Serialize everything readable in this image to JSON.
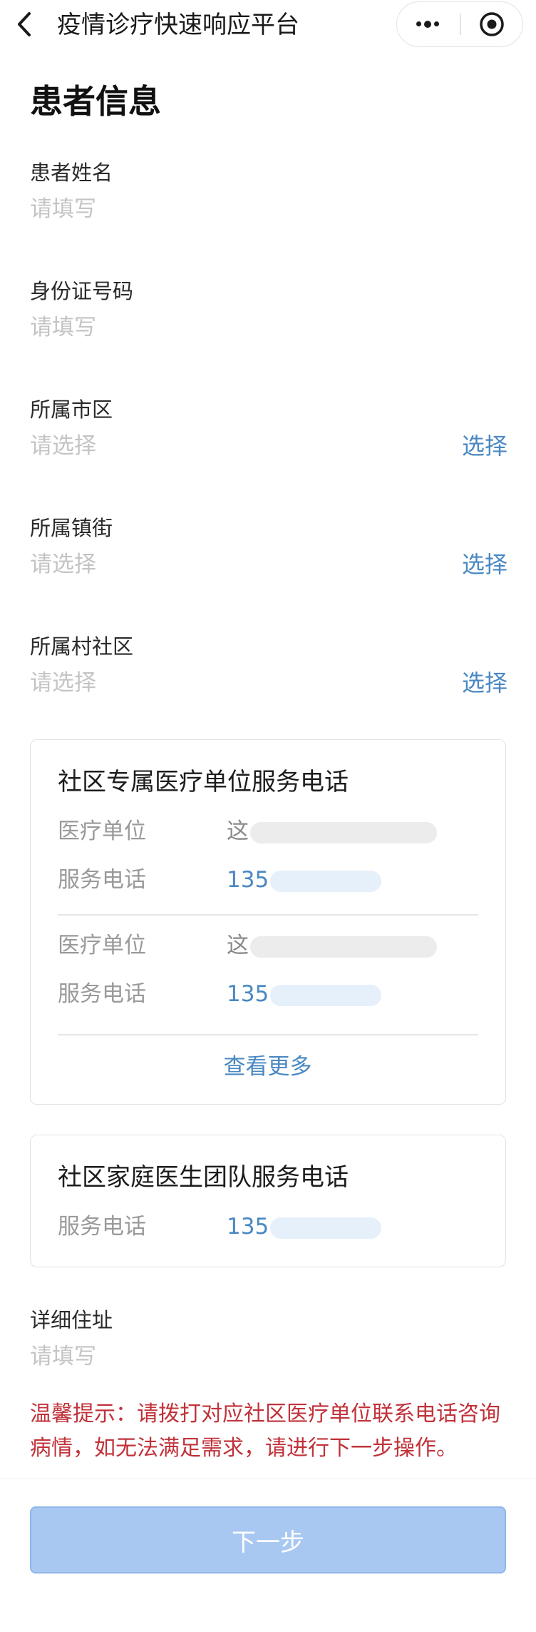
{
  "nav": {
    "title": "疫情诊疗快速响应平台"
  },
  "page": {
    "heading": "患者信息"
  },
  "fields": {
    "patient_name": {
      "label": "患者姓名",
      "placeholder": "请填写",
      "value": ""
    },
    "id_number": {
      "label": "身份证号码",
      "placeholder": "请填写",
      "value": ""
    },
    "city_district": {
      "label": "所属市区",
      "placeholder": "请选择",
      "action": "选择"
    },
    "town_street": {
      "label": "所属镇街",
      "placeholder": "请选择",
      "action": "选择"
    },
    "village_community": {
      "label": "所属村社区",
      "placeholder": "请选择",
      "action": "选择"
    },
    "address": {
      "label": "详细住址",
      "placeholder": "请填写",
      "value": ""
    }
  },
  "medical_card": {
    "title": "社区专属医疗单位服务电话",
    "entries": [
      {
        "unit_label": "医疗单位",
        "unit_value": "这",
        "phone_label": "服务电话",
        "phone_value": "135"
      },
      {
        "unit_label": "医疗单位",
        "unit_value": "这",
        "phone_label": "服务电话",
        "phone_value": "135"
      }
    ],
    "more": "查看更多"
  },
  "family_card": {
    "title": "社区家庭医生团队服务电话",
    "phone_label": "服务电话",
    "phone_value": "135"
  },
  "tip": {
    "text": "温馨提示：请拨打对应社区医疗单位联系电话咨询病情，如无法满足需求，请进行下一步操作。"
  },
  "footer": {
    "next_label": "下一步"
  },
  "colors": {
    "link": "#4a88c2",
    "placeholder": "#c4c4c4",
    "tip": "#c0323a",
    "button_bg": "#a8c8f2"
  }
}
